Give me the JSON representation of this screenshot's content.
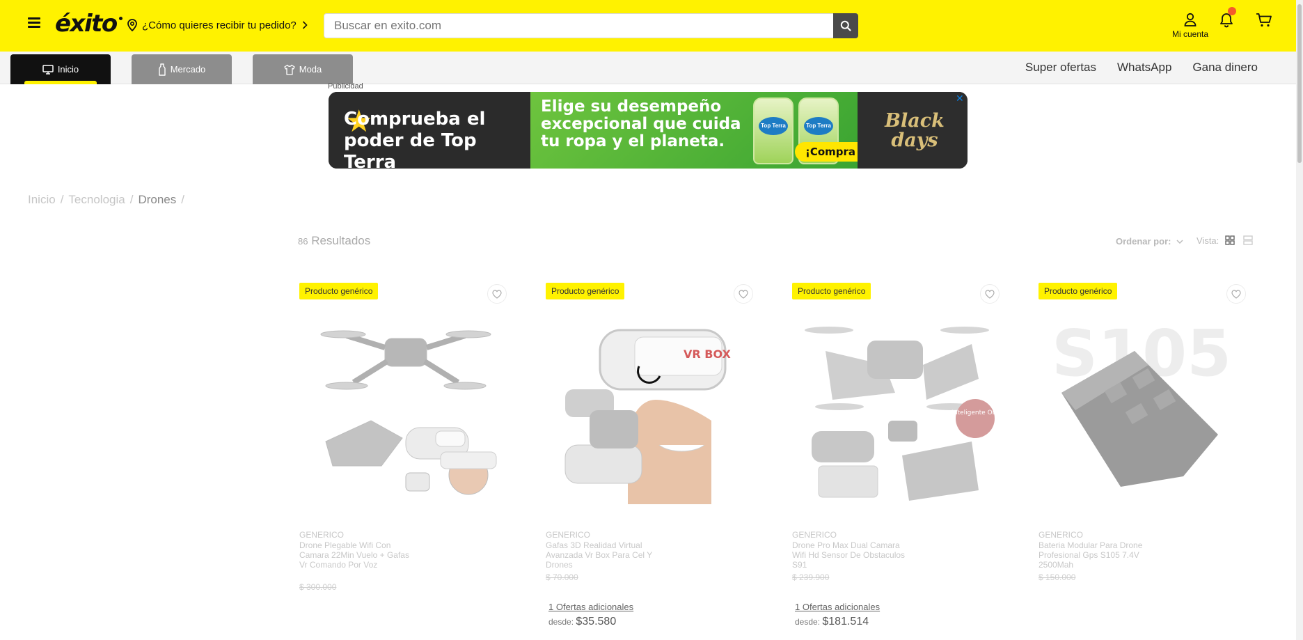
{
  "header": {
    "logo": "éxito",
    "delivery_prompt": "¿Cómo quieres recibir tu pedido?",
    "search_placeholder": "Buscar en exito.com",
    "account_label": "Mi cuenta",
    "colors": {
      "brand_yellow": "#fff200",
      "notification_dot": "#f45b2b"
    }
  },
  "nav": {
    "tabs": [
      {
        "label": "Inicio",
        "icon": "monitor-icon",
        "active": true
      },
      {
        "label": "Mercado",
        "icon": "bottle-icon",
        "active": false
      },
      {
        "label": "Moda",
        "icon": "shirt-icon",
        "active": false
      }
    ],
    "links": [
      "Super ofertas",
      "WhatsApp",
      "Gana dinero"
    ]
  },
  "ad": {
    "label": "Publicidad",
    "headline": "Comprueba el poder de Top Terra",
    "message": "Elige su desempeño excepcional que cuida tu ropa y el planeta.",
    "product_label": "Top Terra",
    "cta": "¡Compra ya!",
    "campaign": "Black days"
  },
  "breadcrumb": {
    "items": [
      "Inicio",
      "Tecnologia"
    ],
    "current": "Drones",
    "separator": "/"
  },
  "results": {
    "count": "86",
    "label": "Resultados",
    "sort_label": "Ordenar por:",
    "view_label": "Vista:"
  },
  "products": [
    {
      "badge": "Producto genérico",
      "brand": "GENERICO",
      "name": "Drone Plegable Wifi Con Camara 22Min Vuelo + Gafas Vr Comando Por Voz",
      "old_price": "$ 300.000"
    },
    {
      "badge": "Producto genérico",
      "brand": "GENERICO",
      "name": "Gafas 3D Realidad Virtual Avanzada Vr Box Para Cel Y Drones",
      "old_price": "$ 70.000",
      "extra_offers": "1 Ofertas adicionales",
      "desde_label": "desde:",
      "desde_price": "$35.580",
      "image_text": "VR BOX"
    },
    {
      "badge": "Producto genérico",
      "brand": "GENERICO",
      "name": "Drone Pro Max Dual Camara Wifi Hd Sensor De Obstaculos S91",
      "old_price": "$ 239.900",
      "extra_offers": "1 Ofertas adicionales",
      "desde_label": "desde:",
      "desde_price": "$181.514",
      "image_badge": "Sensor Inteligente Obstaculos"
    },
    {
      "badge": "Producto genérico",
      "brand": "GENERICO",
      "name": "Bateria Modular Para Drone Profesional Gps S105 7.4V 2500Mah",
      "old_price": "$ 150.000",
      "image_text": "S105"
    }
  ]
}
